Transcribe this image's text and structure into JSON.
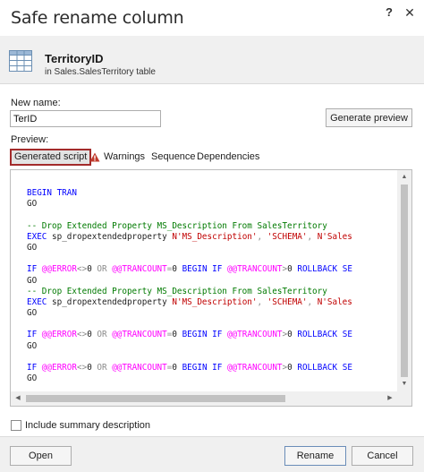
{
  "window": {
    "title": "Safe rename column",
    "help_label": "?",
    "close_label": "✕"
  },
  "header": {
    "object_name": "TerritoryID",
    "object_location": "in Sales.SalesTerritory table",
    "icon": "table-icon"
  },
  "form": {
    "new_name_label": "New name:",
    "new_name_value": "TerID",
    "generate_preview_label": "Generate preview",
    "preview_label": "Preview:"
  },
  "tabs": [
    {
      "label": "Generated script",
      "active": true
    },
    {
      "label": "Warnings",
      "active": false,
      "icon": "warning-icon"
    },
    {
      "label": "Sequence",
      "active": false
    },
    {
      "label": "Dependencies",
      "active": false
    }
  ],
  "script_lines": [
    [
      {
        "t": "BEGIN TRAN",
        "c": "kw"
      }
    ],
    [
      {
        "t": "GO",
        "c": "pl"
      }
    ],
    [],
    [
      {
        "t": "-- Drop Extended Property MS_Description From SalesTerritory",
        "c": "cm"
      }
    ],
    [
      {
        "t": "EXEC ",
        "c": "kw"
      },
      {
        "t": "sp_dropextendedproperty ",
        "c": "pl"
      },
      {
        "t": "N'MS_Description'",
        "c": "str"
      },
      {
        "t": ", ",
        "c": "gr"
      },
      {
        "t": "'SCHEMA'",
        "c": "str"
      },
      {
        "t": ", ",
        "c": "gr"
      },
      {
        "t": "N'Sales",
        "c": "str"
      }
    ],
    [
      {
        "t": "GO",
        "c": "pl"
      }
    ],
    [],
    [
      {
        "t": "IF ",
        "c": "kw"
      },
      {
        "t": "@@ERROR",
        "c": "fn"
      },
      {
        "t": "<>",
        "c": "gr"
      },
      {
        "t": "0 ",
        "c": "pl"
      },
      {
        "t": "OR ",
        "c": "gr"
      },
      {
        "t": "@@TRANCOUNT",
        "c": "fn"
      },
      {
        "t": "=",
        "c": "gr"
      },
      {
        "t": "0 ",
        "c": "pl"
      },
      {
        "t": "BEGIN IF ",
        "c": "kw"
      },
      {
        "t": "@@TRANCOUNT",
        "c": "fn"
      },
      {
        "t": ">",
        "c": "gr"
      },
      {
        "t": "0 ",
        "c": "pl"
      },
      {
        "t": "ROLLBACK SE",
        "c": "kw"
      }
    ],
    [
      {
        "t": "GO",
        "c": "pl"
      }
    ],
    [
      {
        "t": "-- Drop Extended Property MS_Description From SalesTerritory",
        "c": "cm"
      }
    ],
    [
      {
        "t": "EXEC ",
        "c": "kw"
      },
      {
        "t": "sp_dropextendedproperty ",
        "c": "pl"
      },
      {
        "t": "N'MS_Description'",
        "c": "str"
      },
      {
        "t": ", ",
        "c": "gr"
      },
      {
        "t": "'SCHEMA'",
        "c": "str"
      },
      {
        "t": ", ",
        "c": "gr"
      },
      {
        "t": "N'Sales",
        "c": "str"
      }
    ],
    [
      {
        "t": "GO",
        "c": "pl"
      }
    ],
    [],
    [
      {
        "t": "IF ",
        "c": "kw"
      },
      {
        "t": "@@ERROR",
        "c": "fn"
      },
      {
        "t": "<>",
        "c": "gr"
      },
      {
        "t": "0 ",
        "c": "pl"
      },
      {
        "t": "OR ",
        "c": "gr"
      },
      {
        "t": "@@TRANCOUNT",
        "c": "fn"
      },
      {
        "t": "=",
        "c": "gr"
      },
      {
        "t": "0 ",
        "c": "pl"
      },
      {
        "t": "BEGIN IF ",
        "c": "kw"
      },
      {
        "t": "@@TRANCOUNT",
        "c": "fn"
      },
      {
        "t": ">",
        "c": "gr"
      },
      {
        "t": "0 ",
        "c": "pl"
      },
      {
        "t": "ROLLBACK SE",
        "c": "kw"
      }
    ],
    [
      {
        "t": "GO",
        "c": "pl"
      }
    ],
    [],
    [
      {
        "t": "IF ",
        "c": "kw"
      },
      {
        "t": "@@ERROR",
        "c": "fn"
      },
      {
        "t": "<>",
        "c": "gr"
      },
      {
        "t": "0 ",
        "c": "pl"
      },
      {
        "t": "OR ",
        "c": "gr"
      },
      {
        "t": "@@TRANCOUNT",
        "c": "fn"
      },
      {
        "t": "=",
        "c": "gr"
      },
      {
        "t": "0 ",
        "c": "pl"
      },
      {
        "t": "BEGIN IF ",
        "c": "kw"
      },
      {
        "t": "@@TRANCOUNT",
        "c": "fn"
      },
      {
        "t": ">",
        "c": "gr"
      },
      {
        "t": "0 ",
        "c": "pl"
      },
      {
        "t": "ROLLBACK SE",
        "c": "kw"
      }
    ],
    [
      {
        "t": "GO",
        "c": "pl"
      }
    ]
  ],
  "options": {
    "include_summary_label": "Include summary description",
    "include_summary_checked": false
  },
  "footer": {
    "open_label": "Open",
    "rename_label": "Rename",
    "cancel_label": "Cancel"
  },
  "colors": {
    "keyword": "#0000ff",
    "global_variable": "#ff00ff",
    "string": "#c00000",
    "comment": "#007a00",
    "operator": "#8a8a8a",
    "active_tab_border": "#a32b2b",
    "warning": "#c0392b"
  }
}
